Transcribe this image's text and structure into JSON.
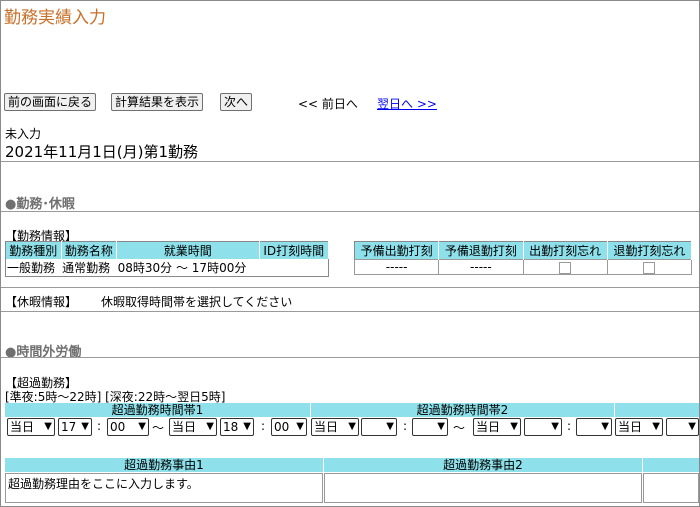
{
  "header": {
    "title": "勤務実績入力"
  },
  "toolbar": {
    "back_label": "前の画面に戻る",
    "calc_label": "計算結果を表示",
    "next_label": "次へ",
    "prev_day": "<< 前日へ",
    "next_day": "翌日へ >>"
  },
  "status": "未入力",
  "date_title": "2021年11月1日(月)第1勤務",
  "sections": {
    "work_leave": "●勤務･休暇",
    "overtime_section": "●時間外労働"
  },
  "work_info": {
    "label": "【勤務情報】",
    "headers": [
      "勤務種別",
      "勤務名称",
      "就業時間",
      "ID打刻時間"
    ],
    "row": {
      "type": "一般勤務",
      "name": "通常勤務",
      "hours": "08時30分 ～ 17時00分",
      "id_time": ""
    },
    "right_headers": [
      "予備出勤打刻",
      "予備退勤打刻",
      "出勤打刻忘れ",
      "退勤打刻忘れ"
    ],
    "right_row": [
      "-----",
      "-----"
    ]
  },
  "leave_info": {
    "label": "【休暇情報】",
    "message": "休暇取得時間帯を選択してください"
  },
  "overtime": {
    "label": "【超過勤務】",
    "note": "[準夜:5時～22時] [深夜:22時～翌日5時]",
    "band1_label": "超過勤務時間帯1",
    "band2_label": "超過勤務時間帯2",
    "band1": {
      "start_day": "当日",
      "start_hour": "17",
      "start_min": "00",
      "end_day": "当日",
      "end_hour": "18",
      "end_min": "00"
    },
    "band2": {
      "start_day": "当日",
      "start_hour": "",
      "start_min": "",
      "end_day": "当日",
      "end_hour": "",
      "end_min": ""
    },
    "band3": {
      "start_day": "当日"
    },
    "reason1_label": "超過勤務事由1",
    "reason2_label": "超過勤務事由2",
    "reason1_value": "超過勤務理由をここに入力します。",
    "reason2_value": ""
  },
  "icons": {
    "dropdown": "chevron-down-icon",
    "resize": "resize-grip-icon"
  },
  "colors": {
    "title": "#c8702a",
    "header_bg": "#8ee0ea",
    "link": "#0000ee"
  }
}
